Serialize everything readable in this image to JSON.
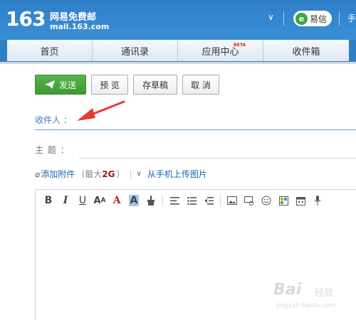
{
  "header": {
    "logo_number": "163",
    "logo_name": "网易免费邮",
    "logo_domain": "mail.163.com",
    "yixin_label": "易信",
    "more_label": "手"
  },
  "nav": {
    "tabs": [
      {
        "label": "首页"
      },
      {
        "label": "通讯录"
      },
      {
        "label": "应用中心",
        "badge": "BETA"
      },
      {
        "label": "收件箱"
      }
    ]
  },
  "toolbar": {
    "send_label": "发送",
    "preview_label": "预 览",
    "draft_label": "存草稿",
    "cancel_label": "取 消"
  },
  "form": {
    "recipient_label": "收件人 ：",
    "subject_label": "主   题 ：",
    "attach_link": "添加附件",
    "attach_limit_prefix": "（最大",
    "attach_limit_size": "2G",
    "attach_limit_suffix": "）",
    "phone_upload": "从手机上传图片"
  },
  "editor": {
    "tools": [
      "B",
      "I",
      "U",
      "A",
      "A",
      "A"
    ]
  },
  "watermark": {
    "brand": "Bai",
    "brand2": "经验",
    "url": "jingyan.baidu.com"
  },
  "colors": {
    "header_blue": "#2f7fc7",
    "send_green": "#4ea845",
    "link_blue": "#1b66b3",
    "annotation_red": "#e63a3a"
  }
}
